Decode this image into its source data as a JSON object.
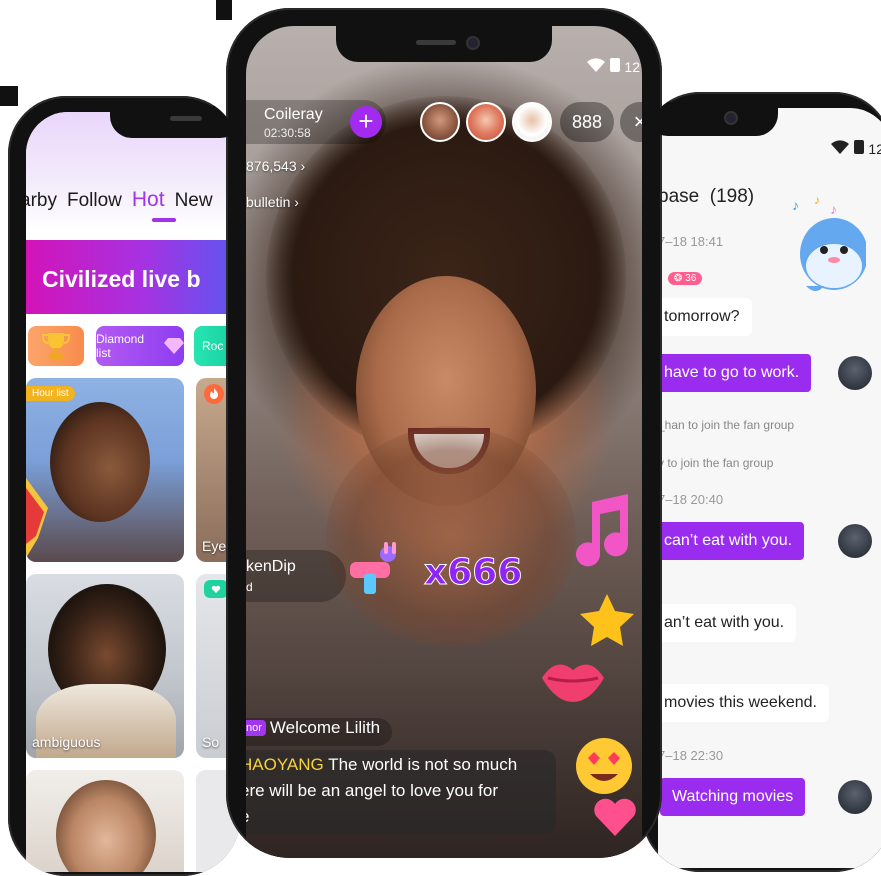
{
  "left_app": {
    "tabs": [
      "arby",
      "Follow",
      "Hot",
      "New"
    ],
    "active_tab": "Hot",
    "banner_text": "Civilized live b",
    "pills": [
      "Diamond list",
      "Roc"
    ],
    "hour_badge": "Hour list",
    "captions": [
      "Eye",
      "ambiguous",
      "So"
    ]
  },
  "center_app": {
    "host": {
      "name": "Coileray",
      "time": "02:30:58"
    },
    "follow_symbol": "+",
    "viewer_count": "888",
    "close_symbol": "×",
    "stats": [
      "876,543 ›",
      "bulletin ›"
    ],
    "gift": {
      "sender": "kenDip",
      "sub": "d",
      "combo": "x666"
    },
    "welcome": {
      "badge": "nor",
      "text": "Welcome Lilith"
    },
    "chat": {
      "user": "HAOYANG",
      "line1": " The world is not so much",
      "line2": "ere will be an angel to love you for",
      "line3": "e"
    },
    "status_time": "12"
  },
  "right_app": {
    "status_time": "12",
    "title": "base  (198)",
    "messages": [
      {
        "kind": "date",
        "text": "7–18 18:41"
      },
      {
        "kind": "badge",
        "text": "36"
      },
      {
        "kind": "white",
        "text": "tomorrow?"
      },
      {
        "kind": "purple",
        "text": "have to go to work."
      },
      {
        "kind": "system",
        "text": "_han to join the fan group"
      },
      {
        "kind": "system",
        "text": "y to join the fan group"
      },
      {
        "kind": "date",
        "text": "7–18 20:40"
      },
      {
        "kind": "purple",
        "text": "can’t eat with you."
      },
      {
        "kind": "white",
        "text": "an’t eat with you."
      },
      {
        "kind": "white",
        "text": "movies this weekend."
      },
      {
        "kind": "date",
        "text": "7–18 22:30"
      },
      {
        "kind": "purple",
        "text": "Watching movies"
      }
    ]
  },
  "colors": {
    "accent": "#9a2cf0",
    "gold": "#f6d23b",
    "badge_pink": "#ff5f8f"
  }
}
